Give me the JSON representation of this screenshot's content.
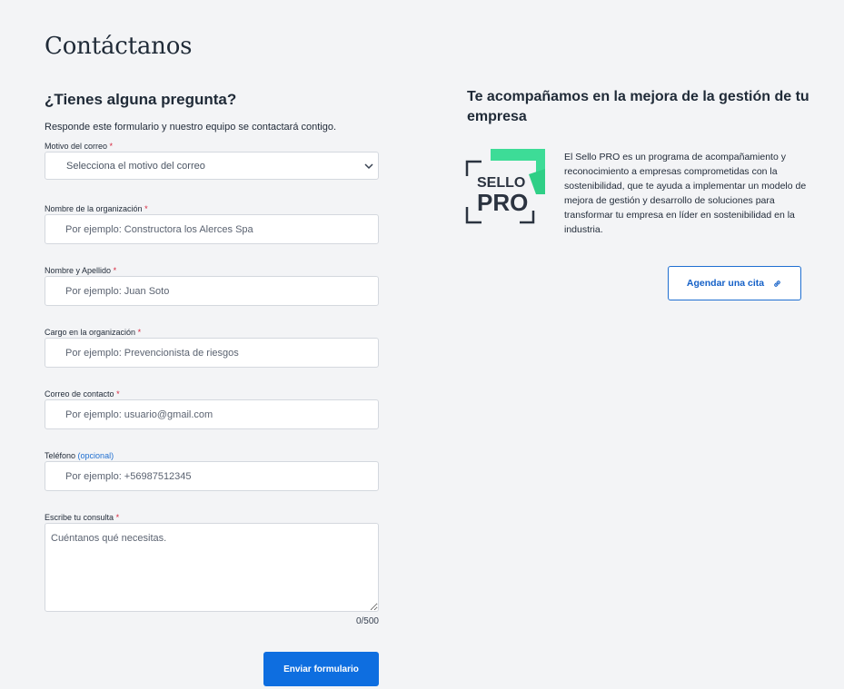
{
  "page": {
    "title": "Contáctanos"
  },
  "form": {
    "heading": "¿Tienes alguna pregunta?",
    "subtitle": "Responde este formulario y nuestro equipo se contactará contigo.",
    "required_mark": "*",
    "fields": {
      "motivo": {
        "label": "Motivo del correo",
        "selected": "Selecciona el motivo del correo"
      },
      "organizacion": {
        "label": "Nombre de la organización",
        "placeholder": "Por ejemplo: Constructora los Alerces Spa"
      },
      "nombre": {
        "label": "Nombre y Apellido",
        "placeholder": "Por ejemplo: Juan Soto"
      },
      "cargo": {
        "label": "Cargo en la organización",
        "placeholder": "Por ejemplo: Prevencionista de riesgos"
      },
      "correo": {
        "label": "Correo de contacto",
        "placeholder": "Por ejemplo: usuario@gmail.com"
      },
      "telefono": {
        "label": "Teléfono",
        "optional_tag": "(opcional)",
        "placeholder": "Por ejemplo: +56987512345"
      },
      "consulta": {
        "label": "Escribe tu consulta",
        "placeholder": "Cuéntanos qué necesitas.",
        "counter": "0/500"
      }
    },
    "submit_label": "Enviar formulario"
  },
  "side": {
    "heading": "Te acompañamos en la mejora de la gestión de tu empresa",
    "description": "El Sello PRO es un programa de acompañamiento y reconocimiento a empresas comprometidas con la sostenibilidad, que te ayuda a implementar un modelo de mejora de gestión y desarrollo de soluciones para transformar tu empresa en líder en sostenibilidad en la industria.",
    "logo": {
      "line1": "SELLO",
      "line2": "PRO",
      "accent_color": "#3ddc97",
      "frame_color": "#2b3340"
    },
    "cta_label": "Agendar una cita",
    "cta_icon": "link-icon"
  },
  "colors": {
    "primary": "#0e6ee0",
    "required": "#d7263d",
    "optional": "#1f6fd1",
    "background": "#f3f4f6"
  }
}
